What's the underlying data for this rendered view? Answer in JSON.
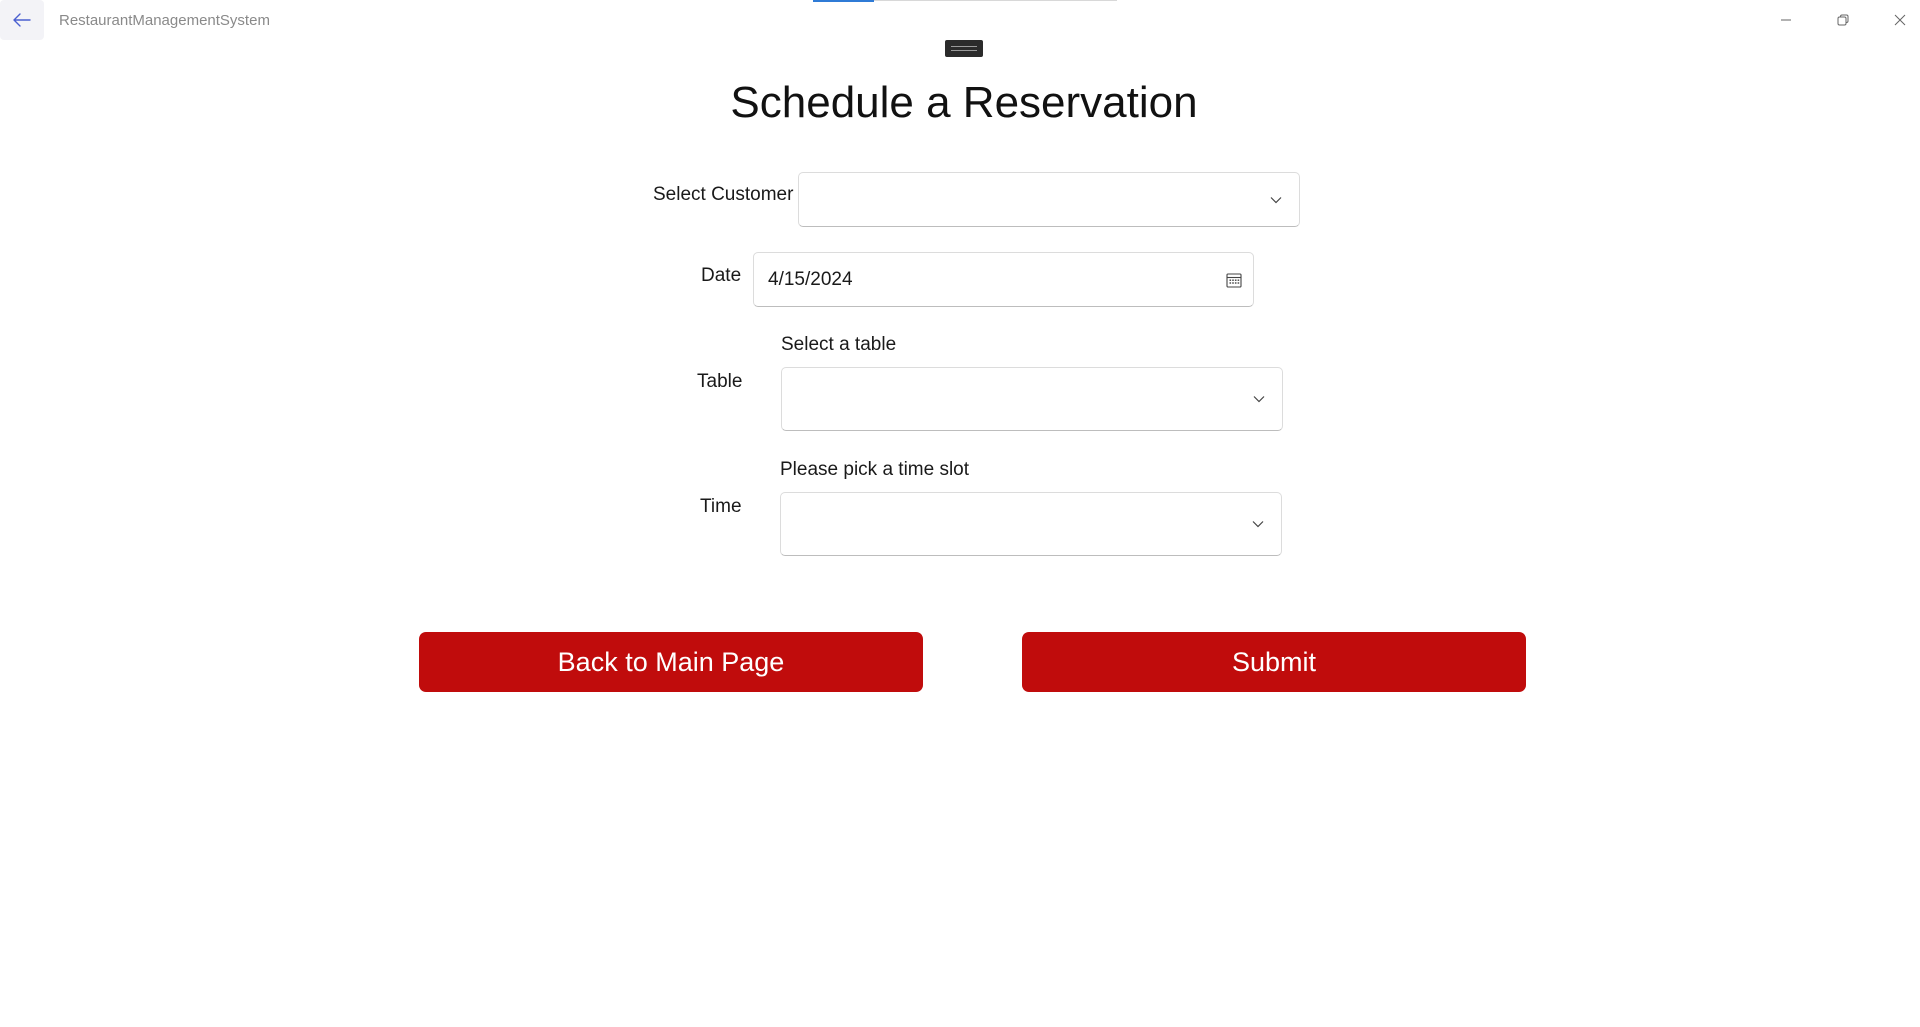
{
  "window": {
    "app_title": "RestaurantManagementSystem",
    "back_icon": "arrow-left-icon",
    "minimize_icon": "minimize-icon",
    "restore_icon": "restore-icon",
    "close_icon": "close-icon"
  },
  "page": {
    "title": "Schedule a Reservation"
  },
  "form": {
    "customer": {
      "label": "Select Customer",
      "value": ""
    },
    "date": {
      "label": "Date",
      "value": "4/15/2024"
    },
    "table": {
      "label": "Table",
      "header": "Select a table",
      "value": ""
    },
    "time": {
      "label": "Time",
      "header": "Please pick a time slot",
      "value": ""
    }
  },
  "actions": {
    "back_label": "Back to Main Page",
    "submit_label": "Submit"
  },
  "colors": {
    "accent_button": "#c00c0c",
    "active_indicator": "#2f7bd6"
  }
}
